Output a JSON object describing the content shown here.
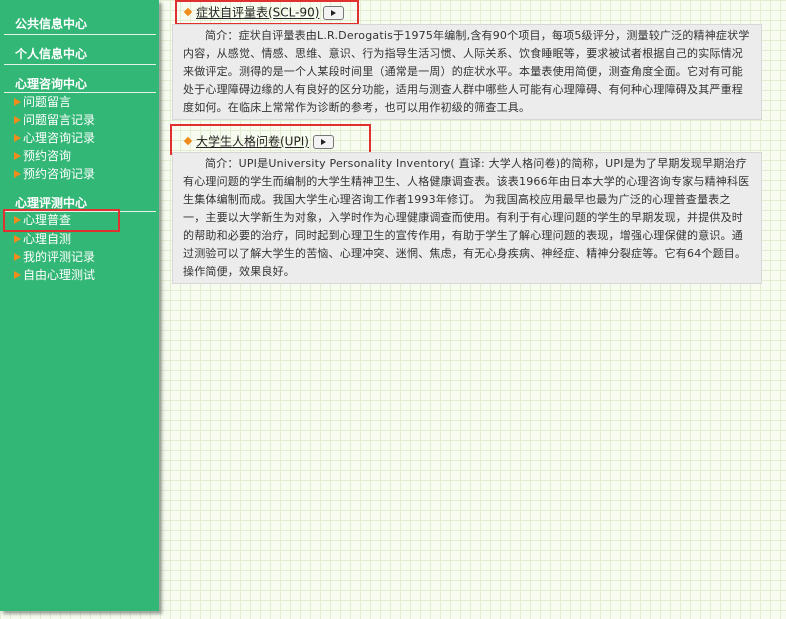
{
  "sidebar": {
    "sections": [
      {
        "title": "公共信息中心",
        "items": []
      },
      {
        "title": "个人信息中心",
        "items": []
      },
      {
        "title": "心理咨询中心",
        "items": [
          "问题留言",
          "问题留言记录",
          "心理咨询记录",
          "预约咨询",
          "预约咨询记录"
        ]
      },
      {
        "title": "心理评测中心",
        "items": [
          "心理普查",
          "心理自测",
          "我的评测记录",
          "自由心理测试"
        ]
      }
    ],
    "active_item": "心理普查"
  },
  "scales": [
    {
      "name": "症状自评量表(SCL-90)",
      "intro": "简介：症状自评量表由L.R.Derogatis于1975年编制,含有90个项目，每项5级评分，测量较广泛的精神症状学内容，从感觉、情感、思维、意识、行为指导生活习惯、人际关系、饮食睡眠等，要求被试者根据自己的实际情况来做评定。测得的是一个人某段时间里（通常是一周）的症状水平。本量表使用简便，测查角度全面。它对有可能处于心理障碍边缘的人有良好的区分功能，适用与测查人群中哪些人可能有心理障碍、有何种心理障碍及其严重程度如何。在临床上常常作为诊断的参考，也可以用作初级的筛查工具。"
    },
    {
      "name": "大学生人格问卷(UPI)",
      "intro": "简介：UPI是University Personality Inventory( 直译: 大学人格问卷)的简称，UPI是为了早期发现早期治疗有心理问题的学生而编制的大学生精神卫生、人格健康调查表。该表1966年由日本大学的心理咨询专家与精神科医生集体编制而成。我国大学生心理咨询工作者1993年修订。 为我国高校应用最早也最为广泛的心理普查量表之一，主要以大学新生为对象，入学时作为心理健康调查而使用。有利于有心理问题的学生的早期发现，并提供及时的帮助和必要的治疗，同时起到心理卫生的宣传作用，有助于学生了解心理问题的表现，增强心理保健的意识。通过测验可以了解大学生的苦恼、心理冲突、迷惘、焦虑，有无心身疾病、神经症、精神分裂症等。它有64个题目。操作简便，效果良好。"
    }
  ],
  "colors": {
    "sidebar_bg": "#33b776",
    "arrow": "#f08c1c",
    "highlight": "#e03030"
  }
}
